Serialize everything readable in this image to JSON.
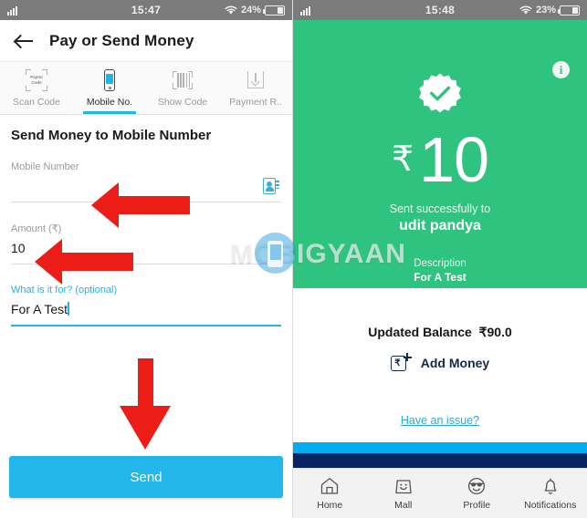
{
  "left_screen": {
    "status_bar": {
      "time": "15:47",
      "battery_percent": "24%",
      "signal_icon": "signal-bars-icon",
      "wifi_icon": "wifi-icon",
      "battery_icon": "battery-icon"
    },
    "app_bar": {
      "back_icon": "back-arrow-icon",
      "title": "Pay or Send Money"
    },
    "tabs": [
      {
        "label": "Scan Code",
        "icon": "scan-code-icon",
        "icon_text_line1": "Paytm",
        "icon_text_line2": "Code",
        "active": false
      },
      {
        "label": "Mobile No.",
        "icon": "mobile-phone-icon",
        "active": true
      },
      {
        "label": "Show Code",
        "icon": "barcode-icon",
        "active": false
      },
      {
        "label": "Payment R..",
        "icon": "payment-request-icon",
        "active": false
      }
    ],
    "form": {
      "title": "Send Money to Mobile Number",
      "mobile": {
        "label": "Mobile Number",
        "value": "",
        "redacted": true,
        "contact_icon": "contact-book-icon"
      },
      "amount": {
        "label": "Amount (₹)",
        "value": "10"
      },
      "note": {
        "label": "What is it for? (optional)",
        "value": "For A Test"
      }
    },
    "send_button": {
      "label": "Send"
    },
    "annotations": [
      {
        "name": "arrow-to-mobile-number",
        "direction": "left"
      },
      {
        "name": "arrow-to-amount",
        "direction": "left"
      },
      {
        "name": "arrow-to-send-button",
        "direction": "down"
      }
    ]
  },
  "right_screen": {
    "status_bar": {
      "time": "15:48",
      "battery_percent": "23%",
      "signal_icon": "signal-bars-icon",
      "wifi_icon": "wifi-icon",
      "battery_icon": "battery-icon"
    },
    "success": {
      "info_icon": "info-icon",
      "info_glyph": "i",
      "check_icon": "success-check-badge-icon",
      "currency_symbol": "₹",
      "amount": "10",
      "sent_text": "Sent successfully to",
      "recipient": "udit pandya",
      "description_label": "Description",
      "description_value": "For A Test",
      "background_color": "#2ec37f"
    },
    "balance": {
      "label": "Updated Balance",
      "value": "₹90.0",
      "add_money": {
        "label": "Add Money",
        "icon": "add-money-icon",
        "glyph": "₹"
      },
      "issue_link": "Have an issue?"
    },
    "bottom_nav": [
      {
        "label": "Home",
        "icon": "home-icon"
      },
      {
        "label": "Mall",
        "icon": "shopping-bag-icon"
      },
      {
        "label": "Profile",
        "icon": "smiley-sunglasses-icon"
      },
      {
        "label": "Notifications",
        "icon": "bell-icon"
      }
    ],
    "accent_bars": {
      "cyan": "#00aeef",
      "navy": "#0a2463"
    }
  },
  "watermark": {
    "text": "MOBIGYAAN",
    "logo_icon": "mobigyaan-phone-logo"
  }
}
